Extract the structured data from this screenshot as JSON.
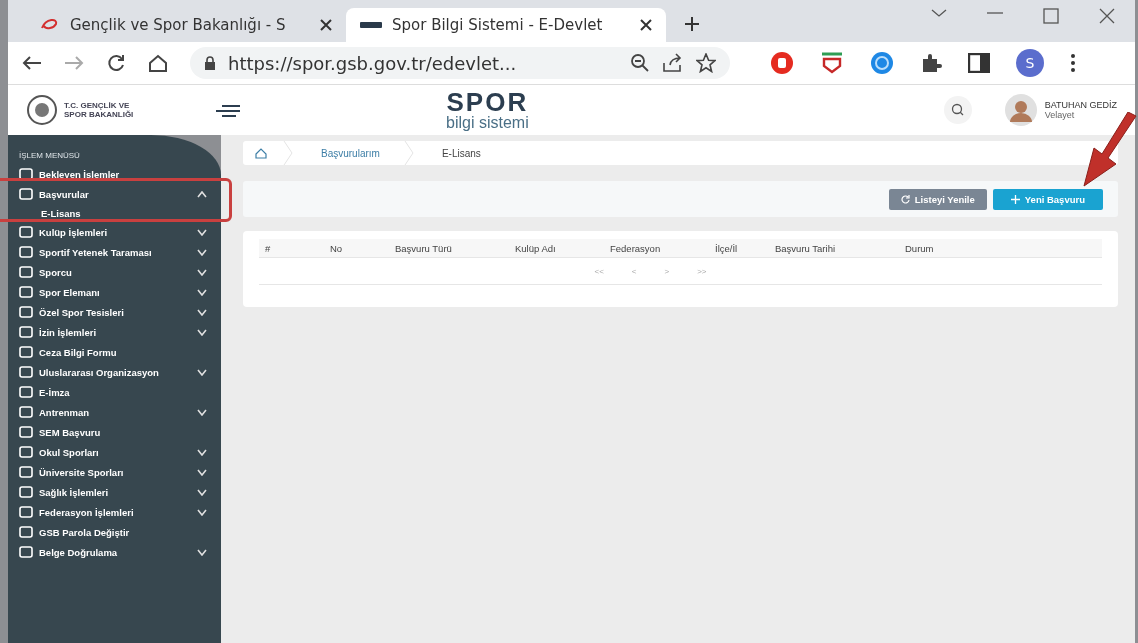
{
  "browser": {
    "tabs": [
      {
        "title": "Gençlik ve Spor Bakanlığı - S",
        "selected": false
      },
      {
        "title": "Spor Bilgi Sistemi - E-Devlet",
        "selected": true
      }
    ],
    "url": "https://spor.gsb.gov.tr/edevlet...",
    "profile_initial": "S"
  },
  "header": {
    "ministry_lines": [
      "T.C. GENÇLİK VE",
      "SPOR BAKANLIĞI"
    ],
    "brand": "SPOR",
    "brand_subtitle": "bilgi sistemi",
    "user_name": "BATUHAN GEDİZ",
    "user_role": "Velayet"
  },
  "sidebar": {
    "heading": "İŞLEM MENÜSÜ",
    "items": [
      {
        "label": "Bekleyen İşlemler",
        "kind": "link"
      },
      {
        "label": "Başvurular",
        "kind": "group",
        "expanded": true,
        "children": [
          {
            "label": "E-Lisans"
          }
        ]
      },
      {
        "label": "Kulüp İşlemleri",
        "kind": "group",
        "expanded": false
      },
      {
        "label": "Sportif Yetenek Taraması",
        "kind": "group",
        "expanded": false
      },
      {
        "label": "Sporcu",
        "kind": "group",
        "expanded": false
      },
      {
        "label": "Spor Elemanı",
        "kind": "group",
        "expanded": false
      },
      {
        "label": "Özel Spor Tesisleri",
        "kind": "group",
        "expanded": false
      },
      {
        "label": "İzin İşlemleri",
        "kind": "group",
        "expanded": false
      },
      {
        "label": "Ceza Bilgi Formu",
        "kind": "link"
      },
      {
        "label": "Uluslararası Organizasyon",
        "kind": "group",
        "expanded": false
      },
      {
        "label": "E-İmza",
        "kind": "link"
      },
      {
        "label": "Antrenman",
        "kind": "group",
        "expanded": false
      },
      {
        "label": "SEM Başvuru",
        "kind": "link"
      },
      {
        "label": "Okul Sporları",
        "kind": "group",
        "expanded": false
      },
      {
        "label": "Üniversite Sporları",
        "kind": "group",
        "expanded": false
      },
      {
        "label": "Sağlık İşlemleri",
        "kind": "group",
        "expanded": false
      },
      {
        "label": "Federasyon İşlemleri",
        "kind": "group",
        "expanded": false
      },
      {
        "label": "GSB Parola Değiştir",
        "kind": "link"
      },
      {
        "label": "Belge Doğrulama",
        "kind": "group",
        "expanded": false
      }
    ]
  },
  "breadcrumb": [
    "Başvurularım",
    "E-Lisans"
  ],
  "toolbar": {
    "buttons": [
      {
        "label": "Listeyi Yenile",
        "kind": "refresh"
      },
      {
        "label": "Yeni Başvuru",
        "kind": "add"
      }
    ]
  },
  "table": {
    "columns": [
      "#",
      "No",
      "Başvuru Türü",
      "Kulüp Adı",
      "Federasyon",
      "İlçe/İl",
      "Başvuru Tarihi",
      "Durum"
    ],
    "pagination": [
      "<<",
      "<",
      ">",
      ">>"
    ]
  },
  "annotations": {
    "highlight_frame": true,
    "arrow": true
  }
}
